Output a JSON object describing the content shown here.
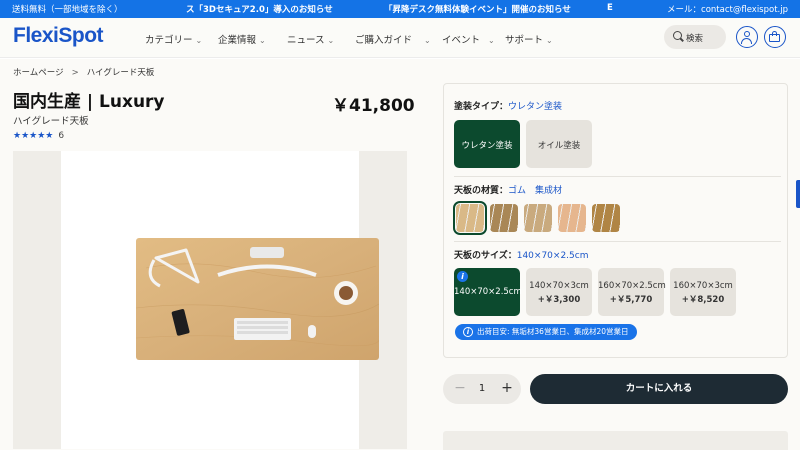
{
  "announcement": {
    "item1": "送料無料（一部地域を除く）",
    "item2": "ス「3Dセキュア2.0」導入のお知らせ",
    "item3": "「昇降デスク無料体験イベント」開催のお知らせ",
    "item4": "E",
    "contact": "メール：contact@flexispot.jp",
    "bar_color": "#1473e6"
  },
  "header": {
    "logo": "FlexiSpot",
    "nav": [
      "カテゴリー",
      "企業情報",
      "ニュース",
      "ご購入ガイド",
      "イベント",
      "サポート"
    ],
    "search_label": "検索",
    "accent": "#1a55c8",
    "icons": {
      "search": "magnifier-icon",
      "user": "user-icon",
      "cart": "cart-icon",
      "chevron": "chevron-down-icon"
    }
  },
  "breadcrumb": {
    "home": "ホームページ",
    "separator": ">",
    "current": "ハイグレード天板"
  },
  "product": {
    "title": "国内生産 | Luxury",
    "subtitle": "ハイグレード天板",
    "price": "￥41,800",
    "stars": "★★★★★",
    "rating_value": 4.5,
    "review_count": "6"
  },
  "options": {
    "finish": {
      "label": "塗装タイプ：",
      "value": "ウレタン塗装",
      "choices": [
        {
          "label": "ウレタン塗装",
          "selected": true
        },
        {
          "label": "オイル塗装",
          "selected": false
        }
      ]
    },
    "material": {
      "label": "天板の材質：",
      "value": "ゴム　集成材",
      "swatch_colors": [
        "#d9b987",
        "#a98756",
        "#c9aa7e",
        "#e6b68e",
        "#b08545"
      ]
    },
    "size": {
      "label": "天板のサイズ：",
      "value": "140×70×2.5cm",
      "choices": [
        {
          "label": "140×70×2.5cm",
          "extra": "",
          "selected": true
        },
        {
          "label": "140×70×3cm",
          "extra": "+￥3,300",
          "selected": false
        },
        {
          "label": "160×70×2.5cm",
          "extra": "+￥5,770",
          "selected": false
        },
        {
          "label": "160×70×3cm",
          "extra": "+￥8,520",
          "selected": false
        }
      ]
    },
    "shipping": "出荷目安: 無垢材36営業日、集成材20営業日"
  },
  "purchase": {
    "quantity": "1",
    "minus": "−",
    "plus": "+",
    "add_to_cart": "カートに入れる"
  },
  "colors": {
    "selected_option": "#0c4a2e",
    "cart_button": "#1e2b34",
    "info_badge": "#1a73e8"
  }
}
